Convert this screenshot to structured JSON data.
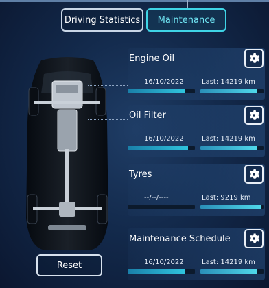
{
  "tabs": [
    {
      "label": "Driving Statistics",
      "active": false
    },
    {
      "label": "Maintenance",
      "active": true
    }
  ],
  "items": [
    {
      "title": "Engine Oil",
      "date": "16/10/2022",
      "last": "Last: 14219  km",
      "left_level": 0.85,
      "right_level": 0.9
    },
    {
      "title": "Oil Filter",
      "date": "16/10/2022",
      "last": "Last: 14219  km",
      "left_level": 0.9,
      "right_level": 0.9
    },
    {
      "title": "Tyres",
      "date": "--/--/----",
      "last": "Last: 9219  km",
      "left_level": 0.0,
      "right_level": 0.97
    },
    {
      "title": "Maintenance Schedule",
      "date": "16/10/2022",
      "last": "Last: 14219  km",
      "left_level": 0.85,
      "right_level": 0.9
    }
  ],
  "reset_label": "Reset",
  "icons": {
    "settings": "gear-icon",
    "vehicle": "car-chassis-image"
  },
  "colors": {
    "accent": "#3fd4e6",
    "background": "#132a4c",
    "bar_fill": "#2fc4de"
  }
}
